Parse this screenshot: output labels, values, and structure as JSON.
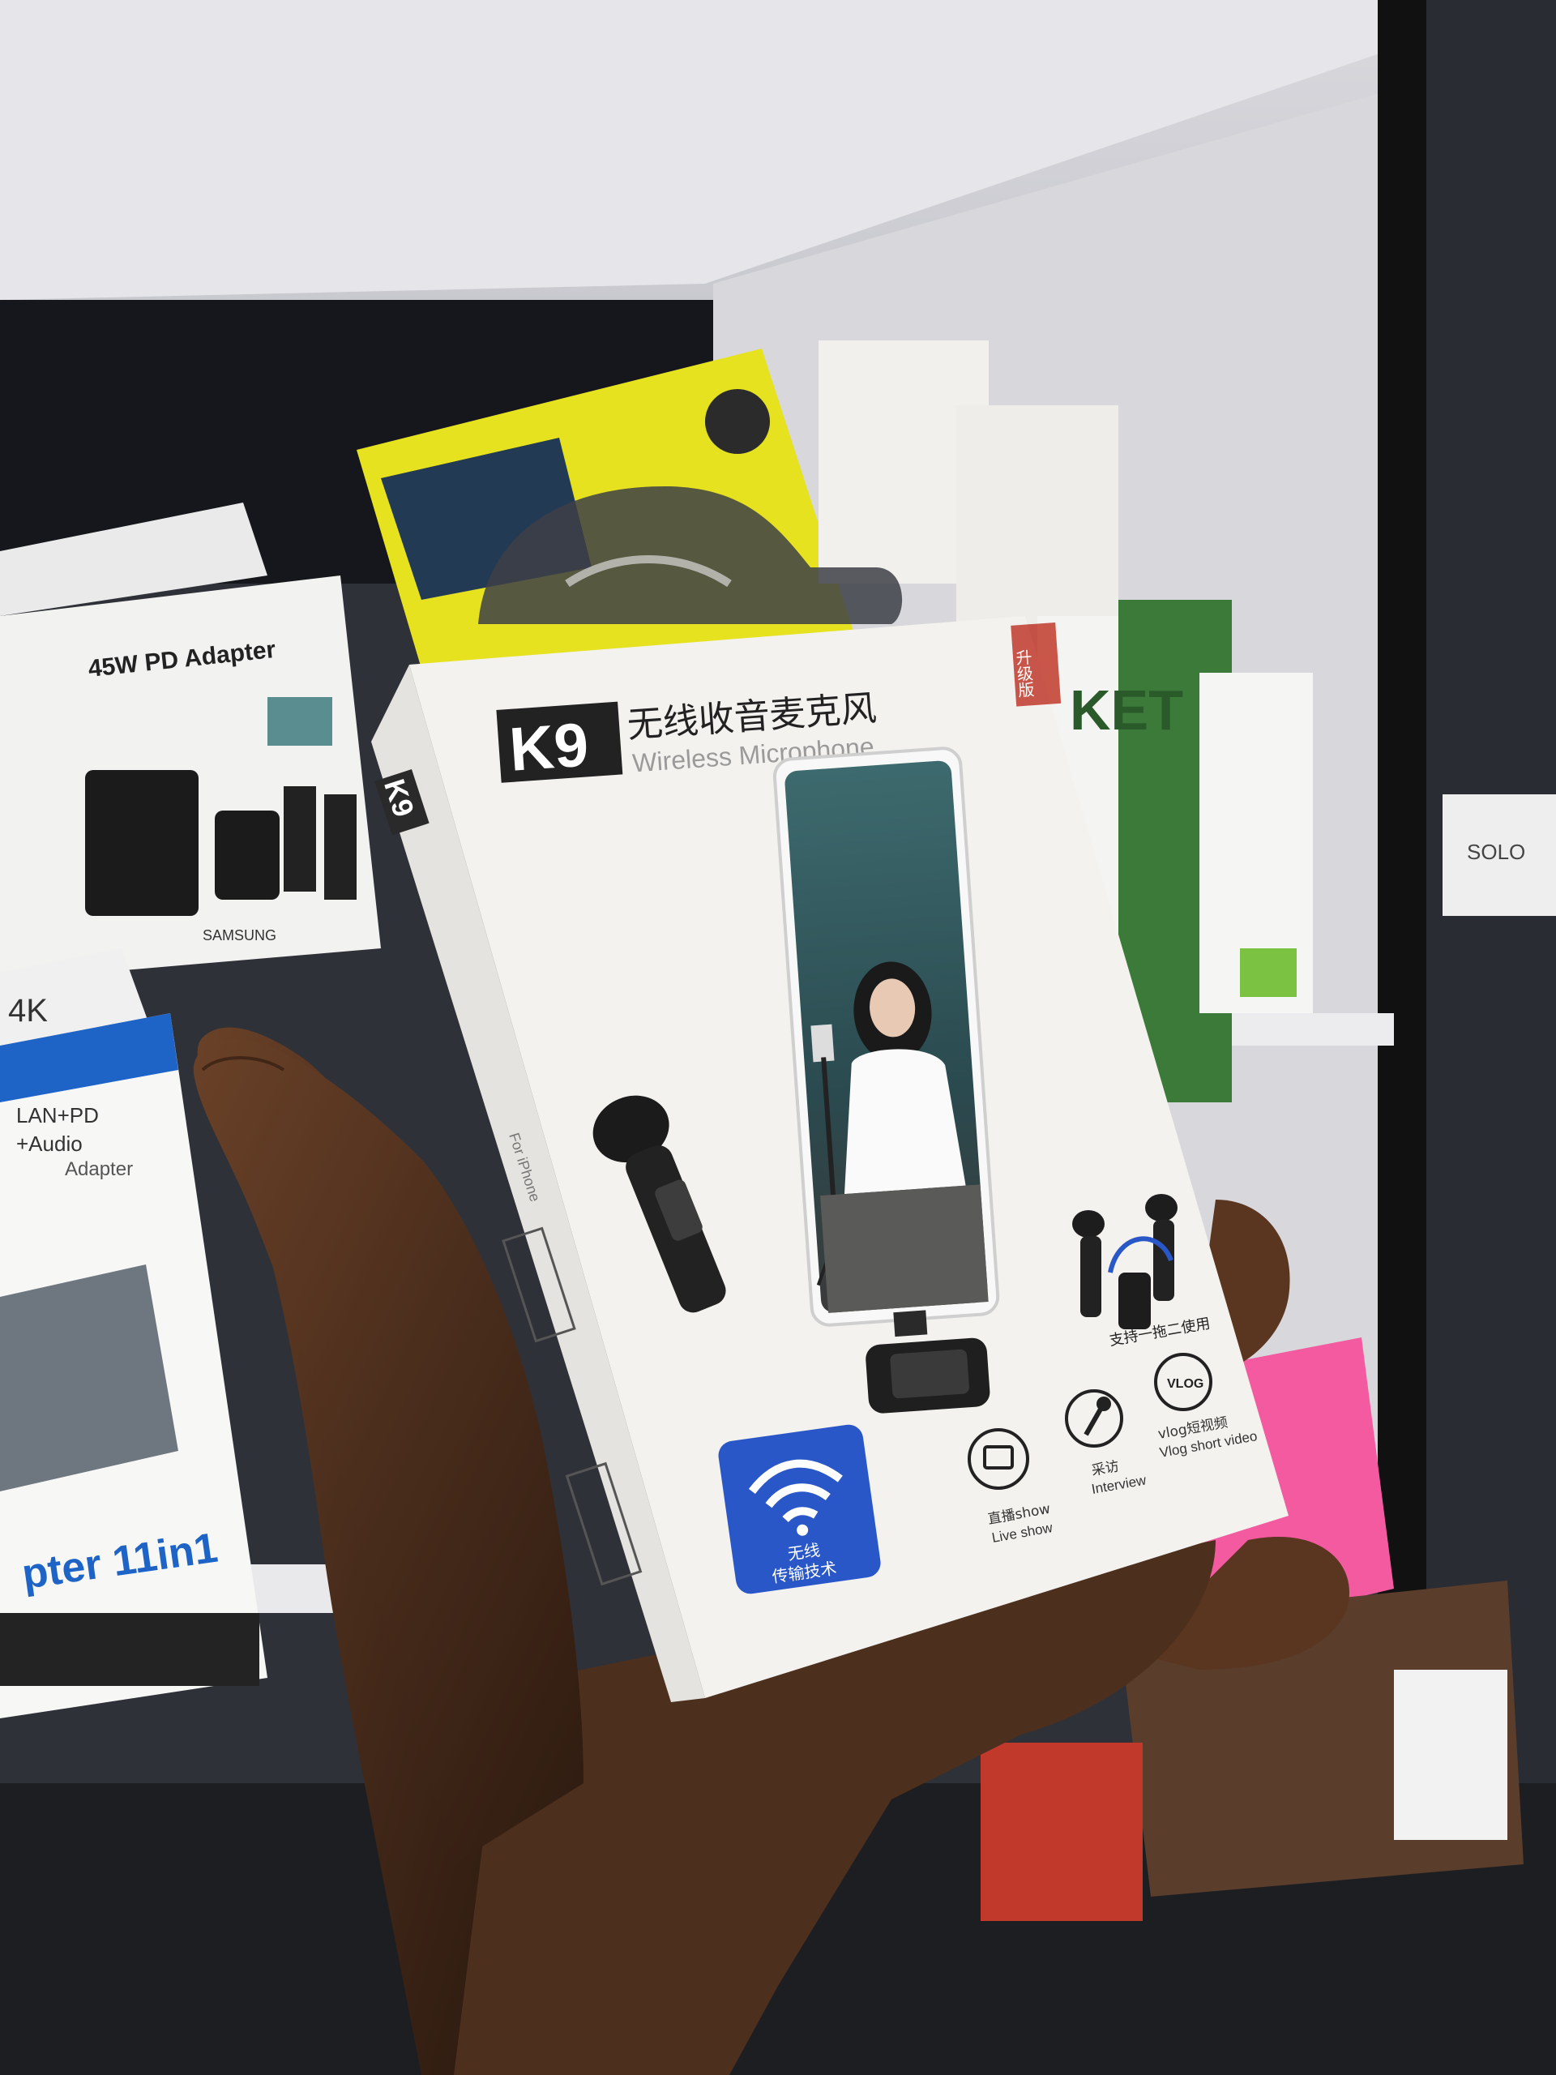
{
  "background": {
    "box_adapter_label": "45W PD Adapter",
    "box_adapter_brand": "SAMSUNG",
    "box_hub_4k": "4K",
    "box_hub_lines": [
      "LAN+PD",
      "+Audio",
      "Adapter"
    ],
    "box_hub_title": "pter 11in1",
    "box_right_partial": "KET",
    "box_right_edge": "SOLO"
  },
  "product": {
    "logo": "K9",
    "title_cn": "无线收音麦克风",
    "title_en": "Wireless Microphone",
    "stamp": "升级版",
    "side_logo": "K9",
    "side_label": "For iPhone",
    "badge_cn_line1": "无线",
    "badge_cn_line2": "传输技术",
    "support_text": "支持一拖二使用",
    "vlog_icon_text": "VLOG",
    "features": [
      {
        "icon": "tv-icon",
        "cn": "直播show",
        "en": "Live show"
      },
      {
        "icon": "mic-icon",
        "cn": "采访",
        "en": "Interview"
      },
      {
        "icon": "vlog-icon",
        "cn": "vlog短视频",
        "en": "Vlog short video"
      }
    ]
  },
  "colors": {
    "wifi_badge": "#2a57c8",
    "box_white": "#f3f2ee",
    "yellow_pack": "#e8e41f",
    "phone_screen": "#2c4d52",
    "skin": "#4a2d1c"
  }
}
